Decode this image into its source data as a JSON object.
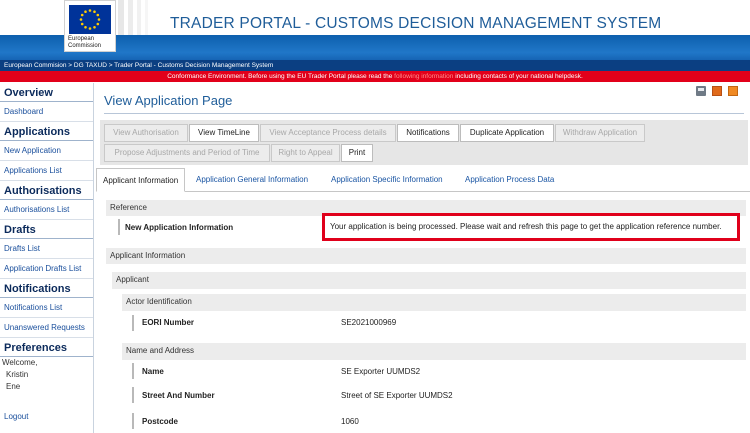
{
  "header": {
    "logo_text": "European Commission",
    "title": "TRADER PORTAL - CUSTOMS DECISION MANAGEMENT SYSTEM"
  },
  "breadcrumb": "European Commision > DG TAXUD > Trader Portal - Customs Decision Management System",
  "conformance": {
    "before": "Conformance Environment. Before using the EU Trader Portal please read the",
    "link": "following information",
    "after": "including contacts of your national helpdesk."
  },
  "sidebar": {
    "overview": "Overview",
    "dashboard": "Dashboard",
    "applications": "Applications",
    "new_application": "New Application",
    "applications_list": "Applications List",
    "authorisations": "Authorisations",
    "authorisations_list": "Authorisations List",
    "drafts": "Drafts",
    "drafts_list": "Drafts List",
    "application_drafts_list": "Application Drafts List",
    "notifications": "Notifications",
    "notifications_list": "Notifications List",
    "unanswered_requests": "Unanswered Requests",
    "preferences": "Preferences",
    "welcome": "Welcome,",
    "user_first": "Kristin",
    "user_last": "Ene",
    "logout": "Logout"
  },
  "page": {
    "title": "View Application Page"
  },
  "toolbar": {
    "view_authorisation": "View Authorisation",
    "view_timeline": "View TimeLine",
    "view_acceptance": "View Acceptance Process details",
    "notifications": "Notifications",
    "duplicate_application": "Duplicate Application",
    "withdraw_application": "Withdraw Application",
    "propose_adjustments": "Propose Adjustments and Period of Time",
    "right_to_appeal": "Right to Appeal",
    "print": "Print"
  },
  "tabs": {
    "applicant_information": "Applicant Information",
    "general_information": "Application General Information",
    "specific_information": "Application Specific Information",
    "process_data": "Application Process Data"
  },
  "content": {
    "reference": "Reference",
    "new_app_info_label": "New Application Information",
    "new_app_info_value": "Your application is being processed. Please wait and refresh this page to get the application reference number.",
    "applicant_information": "Applicant Information",
    "applicant": "Applicant",
    "actor_identification": "Actor Identification",
    "eori_label": "EORI Number",
    "eori_value": "SE2021000969",
    "name_and_address": "Name and Address",
    "name_label": "Name",
    "name_value": "SE Exporter UUMDS2",
    "street_label": "Street And Number",
    "street_value": "Street of SE Exporter UUMDS2",
    "postcode_label": "Postcode",
    "postcode_value": "1060"
  },
  "colors": {
    "brand_blue": "#1f5d99",
    "header_band": "#2077c8",
    "breadcrumb_bar": "#0b3f82",
    "conformance_bar": "#e2001a",
    "highlight_border": "#e0001b"
  },
  "icons": {
    "print": "printer-icon",
    "pdf": "pdf-export-icon",
    "xml": "xml-export-icon",
    "logo": "eu-flag-icon"
  }
}
